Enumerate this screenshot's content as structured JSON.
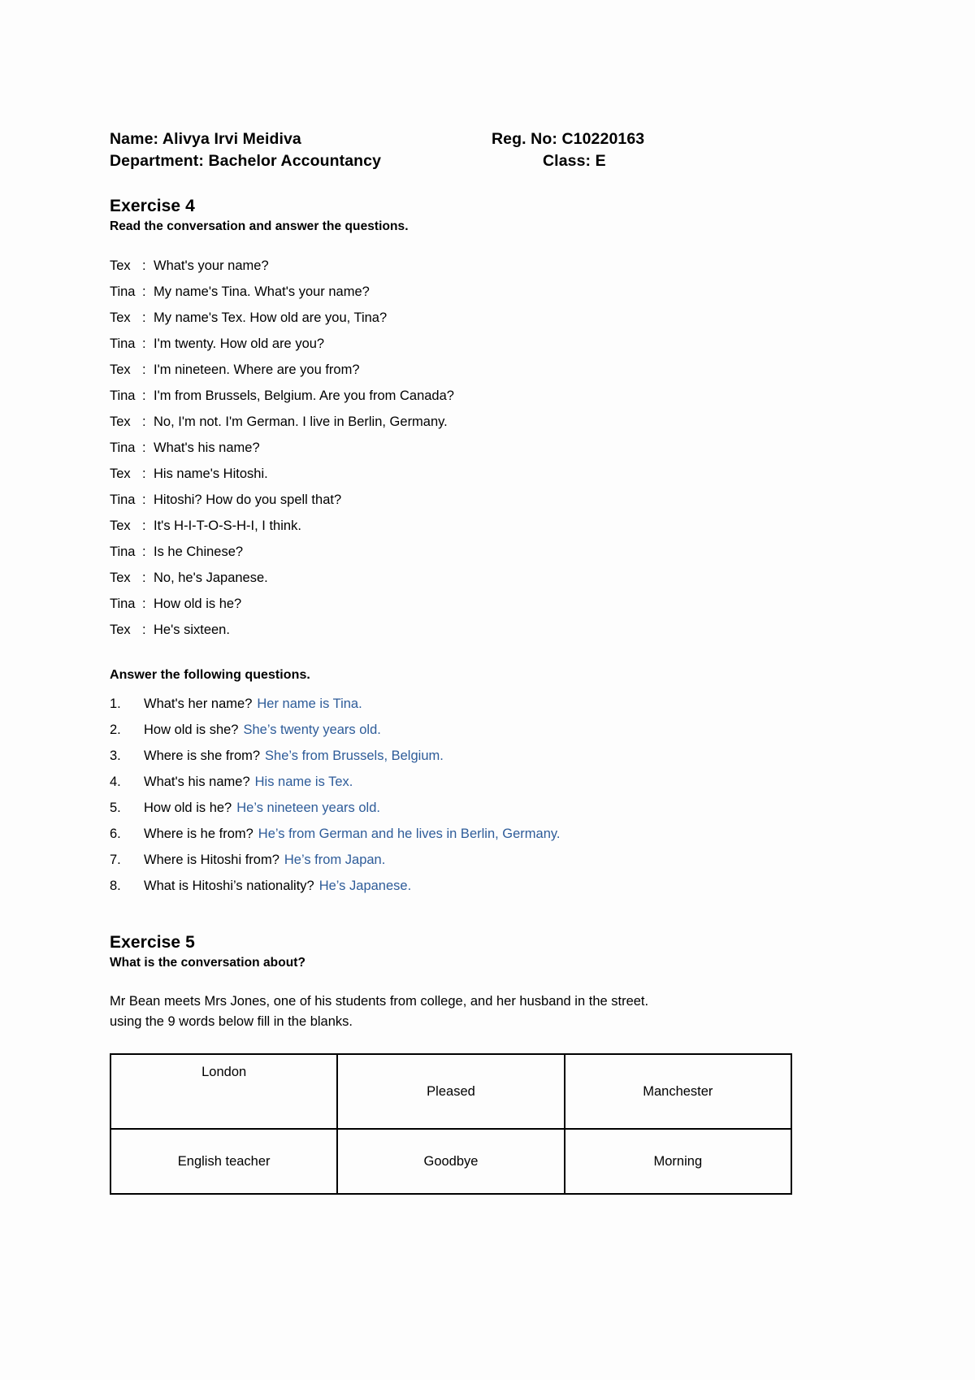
{
  "header": {
    "name_label": "Name: Alivya Irvi Meidiva",
    "reg_label": "Reg. No: C10220163",
    "department_label": "Department: Bachelor Accountancy",
    "class_label": "Class: E"
  },
  "exercise4": {
    "title": "Exercise 4",
    "subtitle": "Read the conversation and answer the questions.",
    "dialogue": [
      {
        "speaker": "Tex",
        "colon": ":",
        "text": "What's your name?"
      },
      {
        "speaker": "Tina",
        "colon": ":",
        "text": "My name's Tina. What's your name?"
      },
      {
        "speaker": "Tex",
        "colon": ":",
        "text": "My name's Tex. How old are you, Tina?"
      },
      {
        "speaker": "Tina",
        "colon": ":",
        "text": "I'm twenty. How old are you?"
      },
      {
        "speaker": "Tex",
        "colon": ":",
        "text": "I'm nineteen. Where are you from?"
      },
      {
        "speaker": "Tina",
        "colon": ":",
        "text": "I'm from Brussels, Belgium. Are you from Canada?"
      },
      {
        "speaker": "Tex",
        "colon": ":",
        "text": "No, I'm not. I'm German. I live in Berlin, Germany."
      },
      {
        "speaker": "Tina",
        "colon": ":",
        "text": "What's his name?"
      },
      {
        "speaker": "Tex",
        "colon": ":",
        "text": "His name's Hitoshi."
      },
      {
        "speaker": "Tina",
        "colon": ":",
        "text": "Hitoshi? How do you spell that?"
      },
      {
        "speaker": "Tex",
        "colon": ":",
        "text": "It's H-I-T-O-S-H-I, I think."
      },
      {
        "speaker": "Tina",
        "colon": ":",
        "text": "Is he Chinese?"
      },
      {
        "speaker": "Tex",
        "colon": ":",
        "text": "No, he's Japanese."
      },
      {
        "speaker": "Tina",
        "colon": ":",
        "text": "How old is he?"
      },
      {
        "speaker": "Tex",
        "colon": ":",
        "text": "He's sixteen."
      }
    ],
    "answers_title": "Answer the following questions.",
    "answers": [
      {
        "num": "1.",
        "question": "What's her name?",
        "answer": "Her name is Tina."
      },
      {
        "num": "2.",
        "question": "How old is she?",
        "answer": "She’s twenty years old."
      },
      {
        "num": "3.",
        "question": "Where is she from?",
        "answer": "She’s from Brussels, Belgium."
      },
      {
        "num": "4.",
        "question": "What's his name?",
        "answer": "His name is Tex."
      },
      {
        "num": "5.",
        "question": "How old is he?",
        "answer": "He’s nineteen years old."
      },
      {
        "num": "6.",
        "question": "Where is he from?",
        "answer": "He’s from German and he lives in Berlin, Germany."
      },
      {
        "num": "7.",
        "question": "Where is Hitoshi from?",
        "answer": "He’s from Japan."
      },
      {
        "num": "8.",
        "question": "What is Hitoshi’s nationality?",
        "answer": "He’s Japanese."
      }
    ]
  },
  "exercise5": {
    "title": "Exercise 5",
    "subtitle": "What is the conversation about?",
    "intro": "Mr Bean meets Mrs Jones, one of his students from college, and her husband in the street.\nusing the 9 words below fill in the blanks.",
    "word_table": {
      "rows": [
        [
          "London",
          "Pleased",
          "Manchester"
        ],
        [
          "English teacher",
          "Goodbye",
          "Morning"
        ]
      ]
    }
  },
  "colors": {
    "answer_blue": "#2E5C99",
    "text_black": "#000000",
    "page_background": "#ffffff",
    "table_border": "#000000"
  }
}
